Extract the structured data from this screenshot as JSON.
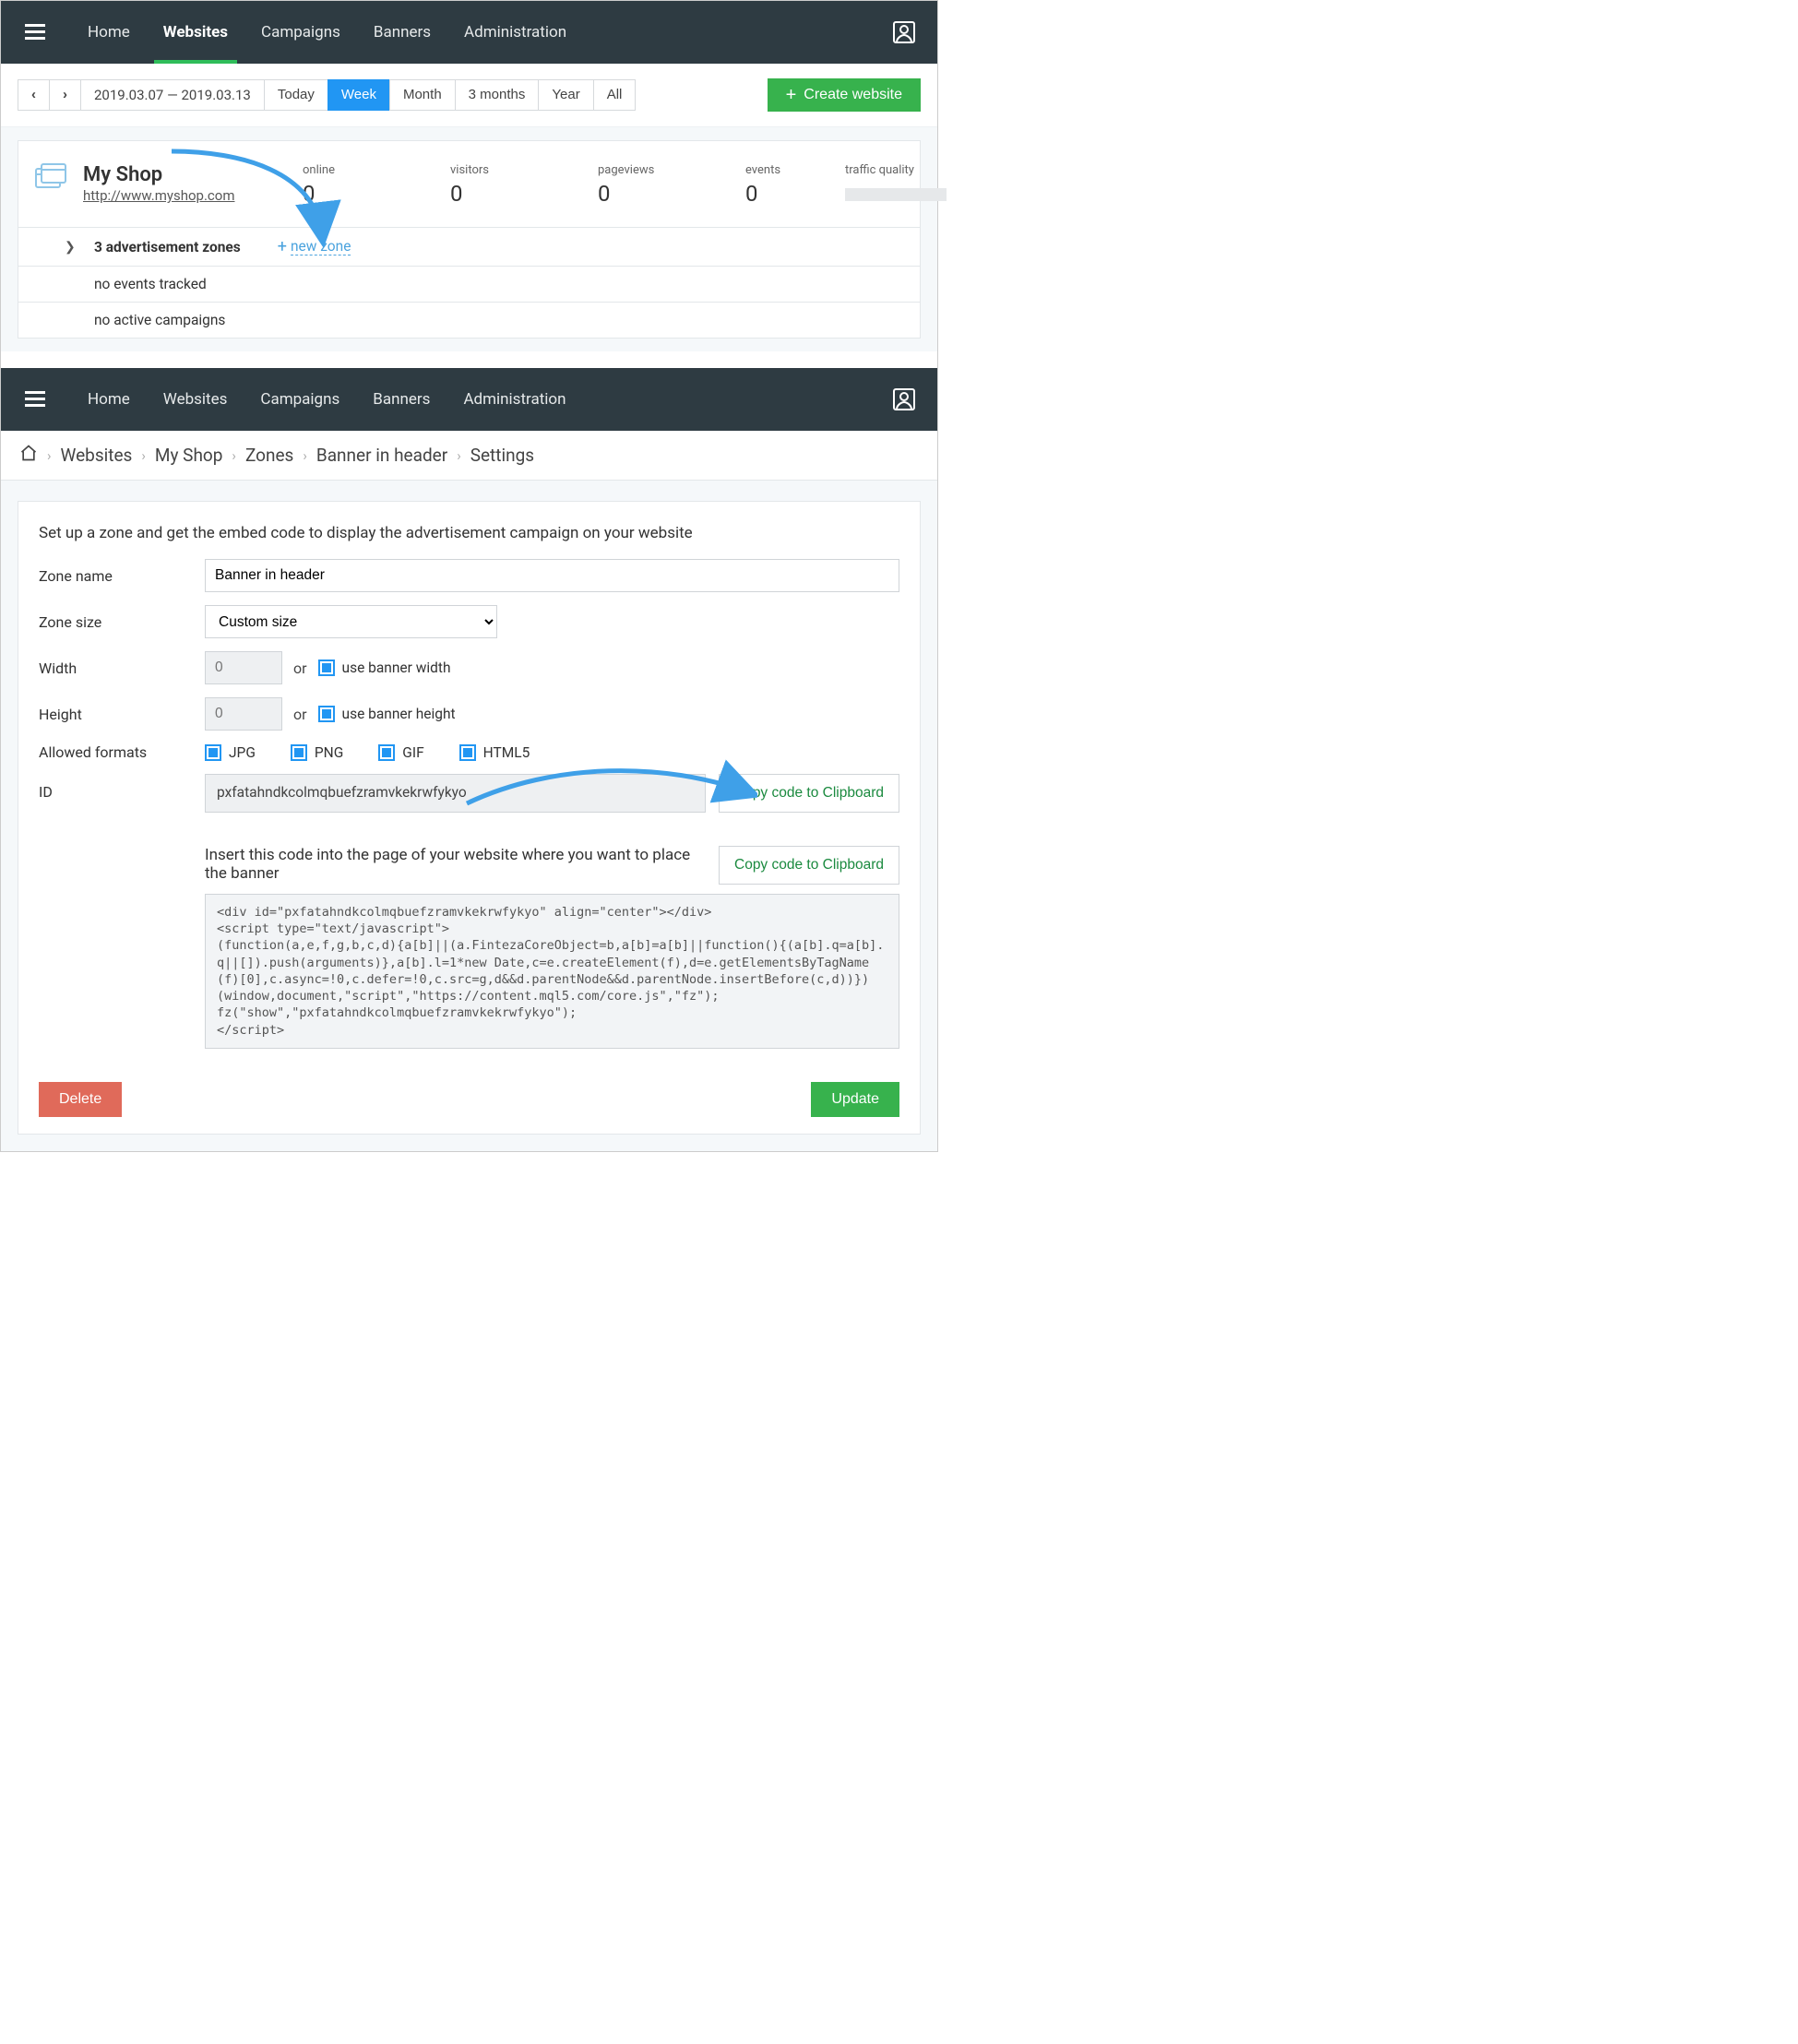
{
  "nav": {
    "items": [
      "Home",
      "Websites",
      "Campaigns",
      "Banners",
      "Administration"
    ],
    "active": 1
  },
  "controls": {
    "date_range": "2019.03.07  — 2019.03.13",
    "periods": [
      "Today",
      "Week",
      "Month",
      "3 months",
      "Year",
      "All"
    ],
    "selected_period": 1,
    "create_website": "Create website"
  },
  "site": {
    "title": "My Shop",
    "url": "http://www.myshop.com",
    "stats": [
      {
        "label": "online",
        "value": "0"
      },
      {
        "label": "visitors",
        "value": "0"
      },
      {
        "label": "pageviews",
        "value": "0"
      },
      {
        "label": "events",
        "value": "0"
      }
    ],
    "quality_label": "traffic quality",
    "row_zones": "3 advertisement zones",
    "new_zone": "new zone",
    "row_events": "no events tracked",
    "row_campaigns": "no active campaigns"
  },
  "breadcrumb": [
    "Websites",
    "My Shop",
    "Zones",
    "Banner in header",
    "Settings"
  ],
  "settings": {
    "intro": "Set up a zone and get the embed code to display the advertisement campaign on your website",
    "labels": {
      "zone_name": "Zone name",
      "zone_size": "Zone size",
      "width": "Width",
      "height": "Height",
      "allowed": "Allowed formats",
      "id": "ID"
    },
    "zone_name_value": "Banner in header",
    "zone_size_value": "Custom size",
    "width_placeholder": "0",
    "height_placeholder": "0",
    "or": "or",
    "use_banner_width": "use banner width",
    "use_banner_height": "use banner height",
    "formats": [
      "JPG",
      "PNG",
      "GIF",
      "HTML5"
    ],
    "id_value": "pxfatahndkcolmqbuefzramvkekrwfykyo",
    "copy_btn": "Copy code to Clipboard",
    "insert_text": "Insert this code into the page of your website where you want to place the banner",
    "code": "<div id=\"pxfatahndkcolmqbuefzramvkekrwfykyo\" align=\"center\"></div>\n<script type=\"text/javascript\">\n(function(a,e,f,g,b,c,d){a[b]||(a.FintezaCoreObject=b,a[b]=a[b]||function(){(a[b].q=a[b].q||[]).push(arguments)},a[b].l=1*new Date,c=e.createElement(f),d=e.getElementsByTagName(f)[0],c.async=!0,c.defer=!0,c.src=g,d&&d.parentNode&&d.parentNode.insertBefore(c,d))})\n(window,document,\"script\",\"https://content.mql5.com/core.js\",\"fz\");\nfz(\"show\",\"pxfatahndkcolmqbuefzramvkekrwfykyo\");\n</script>",
    "delete": "Delete",
    "update": "Update"
  }
}
